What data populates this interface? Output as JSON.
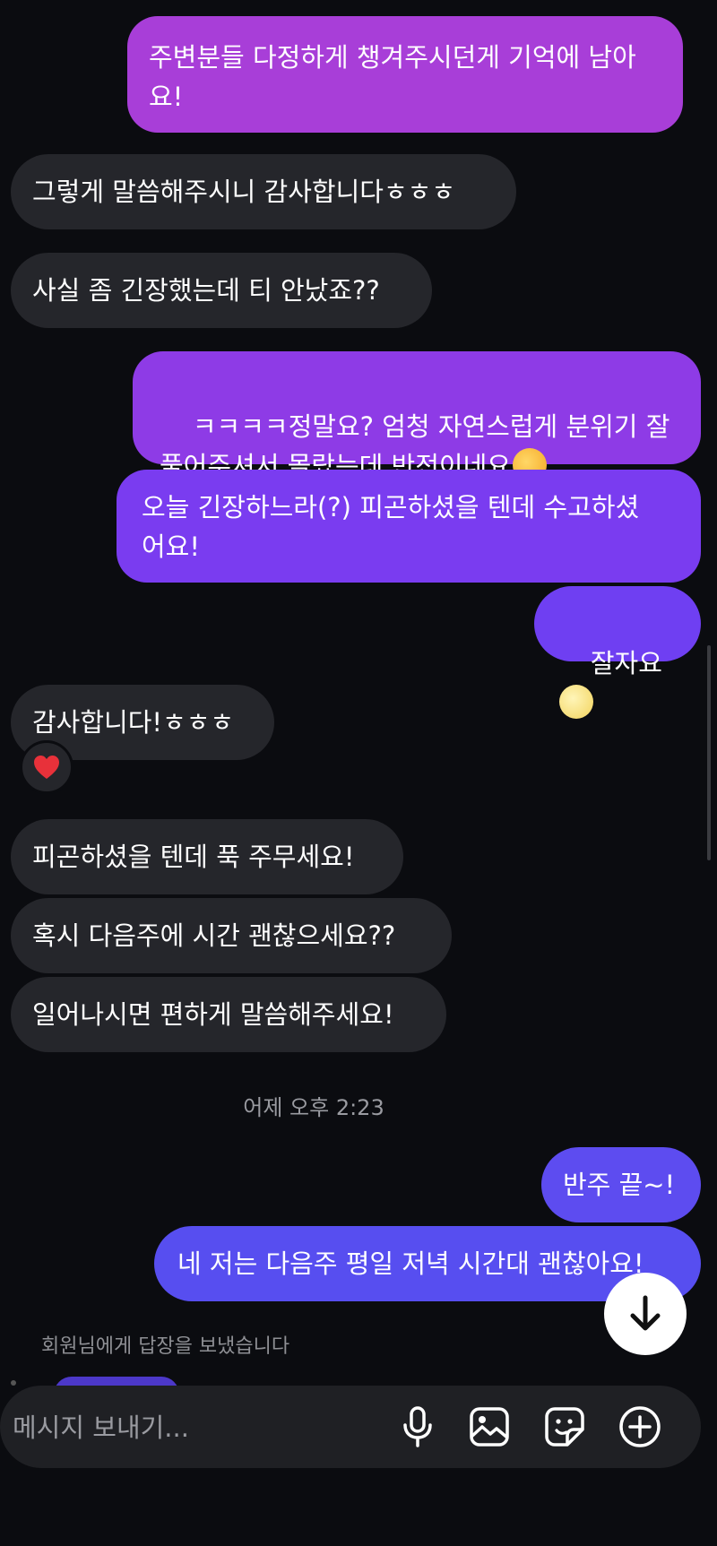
{
  "messages": [
    {
      "text": "주변분들 다정하게 챙겨주시던게 기억에 남아\n요!"
    },
    {
      "text": "그렇게 말씀해주시니 감사합니다ㅎㅎㅎ"
    },
    {
      "text": "사실 좀 긴장했는데 티 안났죠??"
    },
    {
      "text": "ㅋㅋㅋㅋ정말요? 엄청 자연스럽게 분위기 잘\n풀어주셔서 몰랐는데 반전이네요"
    },
    {
      "text": "오늘 긴장하느라(?) 피곤하셨을 텐데 수고하셨\n어요!"
    },
    {
      "text": "잘자요"
    },
    {
      "text": "감사합니다!ㅎㅎㅎ"
    },
    {
      "text": "피곤하셨을 텐데 푹 주무세요!"
    },
    {
      "text": "혹시 다음주에 시간 괜찮으세요??"
    },
    {
      "text": "일어나시면 편하게 말씀해주세요!"
    },
    {
      "text": "반주 끝~!"
    },
    {
      "text": "네 저는 다음주 평일 저녁 시간대 괜찮아요!"
    }
  ],
  "timestamp": "어제 오후 2:23",
  "reply_status": "회원님에게 답장을 보냈습니다",
  "composer": {
    "placeholder": "메시지 보내기..."
  },
  "colors": {
    "background": "#0b0c10",
    "incoming": "#25262b",
    "outgoing_top": "#a53fe0",
    "outgoing_bottom": "#5b4bf0"
  },
  "icons": {
    "reaction": "heart-icon",
    "scroll": "arrow-down-icon",
    "mic": "microphone-icon",
    "gallery": "image-icon",
    "sticker": "sticker-icon",
    "more": "plus-circle-icon"
  }
}
